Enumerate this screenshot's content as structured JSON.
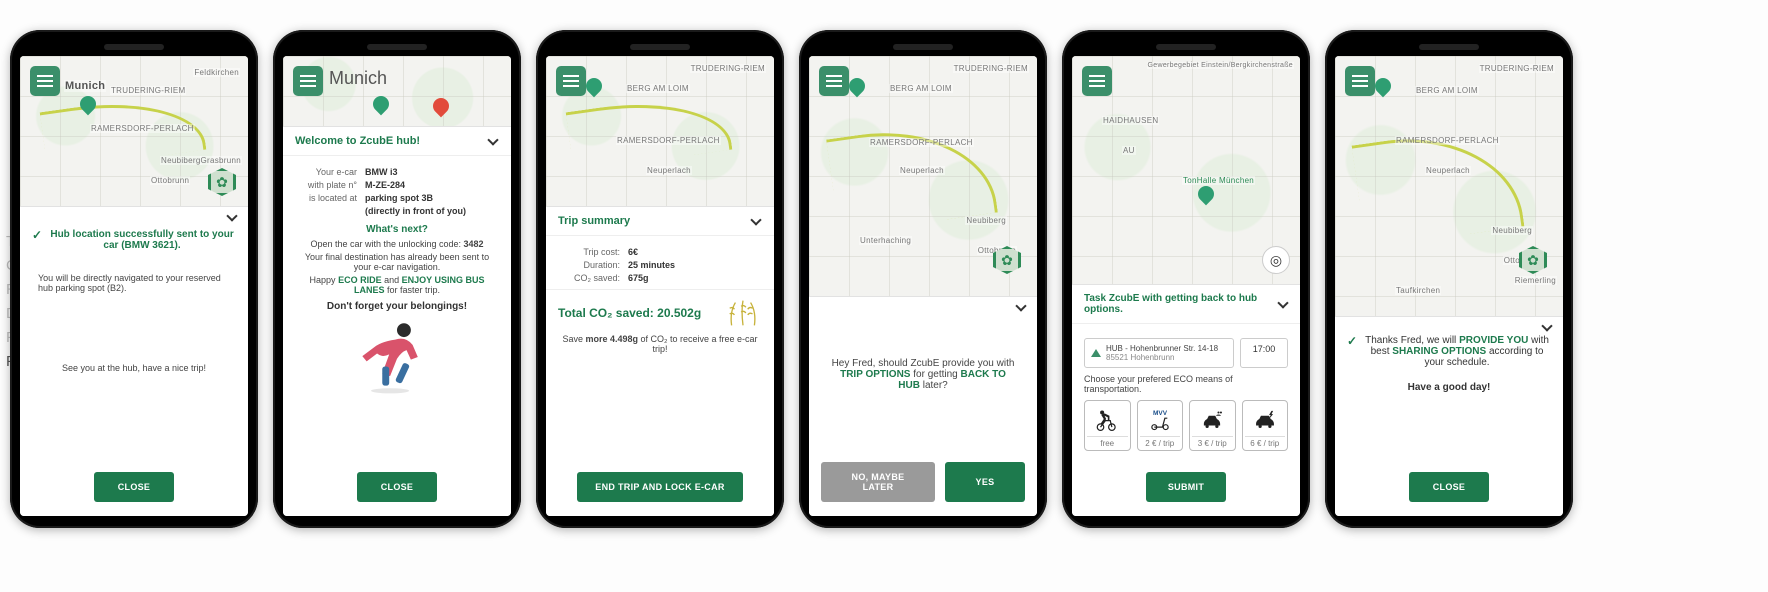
{
  "sidebar_nav": {
    "items": [
      "Top of the Page",
      "Context",
      "Research",
      "Definition",
      "Final Concept to MVP",
      "Final Ui Design"
    ],
    "active_index": 5
  },
  "common": {
    "map_labels": {
      "munich": "Munich",
      "berg": "BERG AM LOIM",
      "trudering": "TRUDERING-RIEM",
      "ramersdorf": "RAMERSDORF-PERLACH",
      "neuperlach": "Neuperlach",
      "unterhaching": "Unterhaching",
      "taufkirchen": "Taufkirchen",
      "neubiberg": "Neubiberg",
      "ottobrunn": "Ottobrunn",
      "riemerling": "Riemerling",
      "haidhausen": "HAIDHAUSEN",
      "au": "AU",
      "tonhalle": "TonHalle München",
      "feldkirchen": "Feldkirchen",
      "grasbrunn": "Grasbrunn",
      "gewerbe": "Gewerbegebiet Einstein/Bergkirchenstraße"
    }
  },
  "screens": [
    {
      "city": "Munich",
      "confirm_line": "Hub location successfully sent to your car (BMW 3621).",
      "body1": "You will be directly navigated to your reserved hub parking spot (B2).",
      "body2": "See you at the hub, have a nice trip!",
      "button": "CLOSE"
    },
    {
      "city": "Munich",
      "header": "Welcome to ZcubE hub!",
      "kv": [
        {
          "k": "Your e-car",
          "v": "BMW i3"
        },
        {
          "k": "with plate n°",
          "v": "M-ZE-284"
        },
        {
          "k": "is located at",
          "v": "parking spot 3B"
        },
        {
          "k": "",
          "v": "(directly in front of you)"
        }
      ],
      "whats_next": "What's next?",
      "unlock_pre": "Open the car with the unlocking code: ",
      "unlock_code": "3482",
      "sent_line": "Your final destination has already been sent to your e-car navigation.",
      "eco_pre": "Happy ",
      "eco_ride": "ECO RIDE",
      "eco_mid": " and ",
      "eco_bus": "ENJOY USING BUS LANES",
      "eco_post": " for faster trip.",
      "belongings": "Don't forget your belongings!",
      "button": "CLOSE"
    },
    {
      "header": "Trip summary",
      "kv": [
        {
          "k": "Trip cost:",
          "v": "6€"
        },
        {
          "k": "Duration:",
          "v": "25 minutes"
        },
        {
          "k": "CO₂ saved:",
          "v": "675g"
        }
      ],
      "total_label": "Total CO₂ saved: ",
      "total_value": "20.502g",
      "save_pre": "Save ",
      "save_bold": "more 4.498g",
      "save_post": " of CO₂ to receive a free e-car trip!",
      "button": "END TRIP AND LOCK E-CAR"
    },
    {
      "question_pre": "Hey Fred, should ZcubE provide you with ",
      "question_hl1": "TRIP OPTIONS",
      "question_mid": " for getting ",
      "question_hl2": "BACK TO HUB",
      "question_post": " later?",
      "btn_no": "NO, MAYBE LATER",
      "btn_yes": "YES"
    },
    {
      "header": "Task ZcubE with getting back to hub options.",
      "dest_line1": "HUB - Hohenbrunner Str. 14-18",
      "dest_line2": "85521 Hohenbrunn",
      "time": "17:00",
      "choose_line": "Choose your prefered ECO means of transportation.",
      "modes": [
        {
          "name": "walk-bike",
          "price": "free"
        },
        {
          "name": "mvv-scooter",
          "price": "2 € / trip"
        },
        {
          "name": "ride-share",
          "price": "3 € / trip"
        },
        {
          "name": "e-car",
          "price": "6 € / trip"
        }
      ],
      "button": "SUBMIT"
    },
    {
      "confirm_pre": "Thanks Fred, we will ",
      "confirm_hl1": "PROVIDE YOU",
      "confirm_mid": " with best ",
      "confirm_hl2": "SHARING OPTIONS",
      "confirm_post": " according to your schedule.",
      "day": "Have a good day!",
      "button": "CLOSE"
    }
  ]
}
